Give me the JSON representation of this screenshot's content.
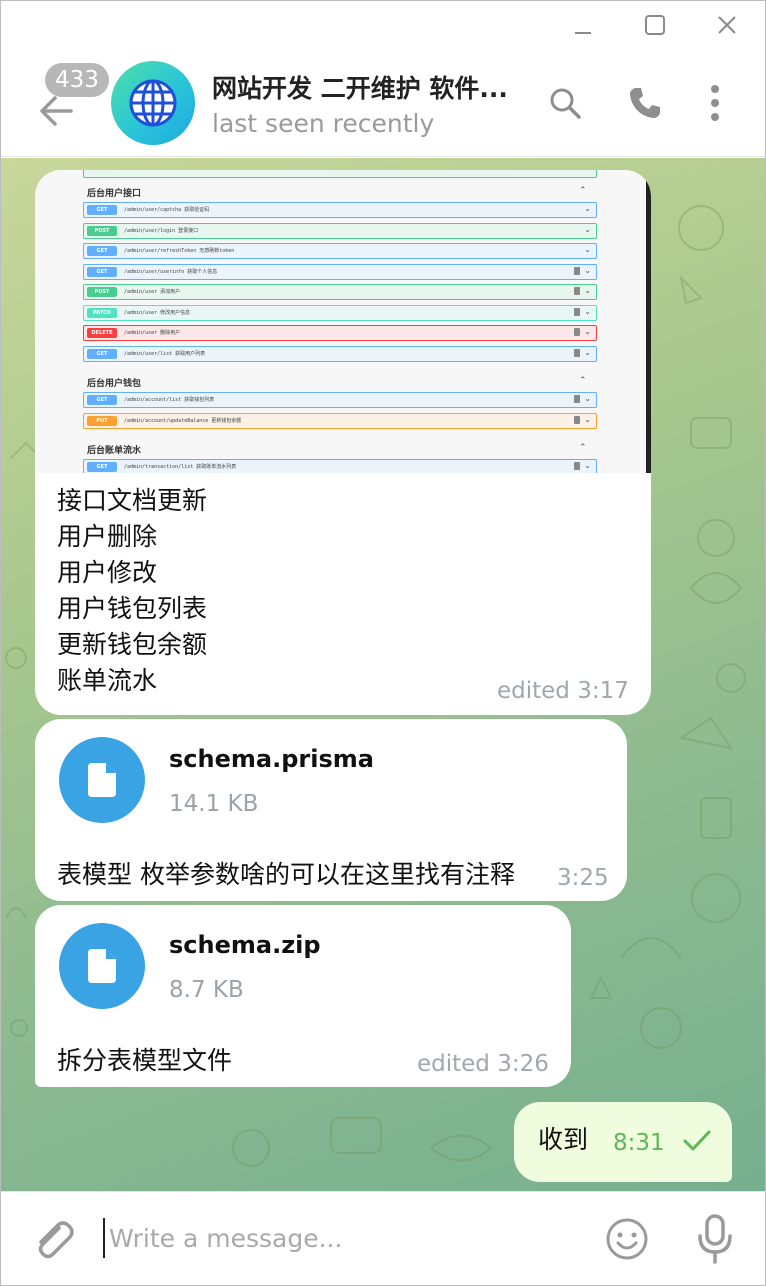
{
  "window": {
    "minimize_icon": "minimize-icon",
    "maximize_icon": "maximize-icon",
    "close_icon": "close-icon"
  },
  "header": {
    "unread_count": "433",
    "title": "网站开发 二开维护 软件...",
    "status": "last seen recently",
    "avatar_icon": "globe-icon",
    "icons": [
      "back-arrow-icon",
      "search-icon",
      "phone-icon",
      "more-vertical-icon"
    ]
  },
  "screenshot": {
    "sections": [
      {
        "title": "后台用户接口",
        "endpoints": [
          {
            "method": "GET",
            "path": "/admin/user/captcha  获取验证码",
            "locked": false
          },
          {
            "method": "POST",
            "path": "/admin/user/login  登录接口",
            "locked": false
          },
          {
            "method": "GET",
            "path": "/admin/user/refreshToken  无感刷新token",
            "locked": false
          },
          {
            "method": "GET",
            "path": "/admin/user/userinfo  获取个人信息",
            "locked": true
          },
          {
            "method": "POST",
            "path": "/admin/user  添加用户",
            "locked": true
          },
          {
            "method": "PATCH",
            "path": "/admin/user  修改用户信息",
            "locked": true
          },
          {
            "method": "DELETE",
            "path": "/admin/user  删除用户",
            "locked": true
          },
          {
            "method": "GET",
            "path": "/admin/user/list  获取用户列表",
            "locked": true
          }
        ]
      },
      {
        "title": "后台用户钱包",
        "endpoints": [
          {
            "method": "GET",
            "path": "/admin/account/list  获取钱包列表",
            "locked": true
          },
          {
            "method": "PUT",
            "path": "/admin/account/updateBalance  更新钱包余额",
            "locked": true
          }
        ]
      },
      {
        "title": "后台账单流水",
        "endpoints": [
          {
            "method": "GET",
            "path": "/admin/transaction/list  获取账单流水列表",
            "locked": true
          }
        ]
      }
    ]
  },
  "messages": {
    "m1": {
      "lines": [
        "接口文档更新",
        "用户删除",
        "用户修改",
        "用户钱包列表",
        "更新钱包余额",
        "账单流水"
      ],
      "time": "edited 3:17"
    },
    "m2": {
      "file_name": "schema.prisma",
      "file_size": "14.1 KB",
      "caption": "表模型 枚举参数啥的可以在这里找有注释",
      "time": "3:25",
      "icon": "file-icon"
    },
    "m3": {
      "file_name": "schema.zip",
      "file_size": "8.7 KB",
      "caption": "拆分表模型文件",
      "time": "edited 3:26",
      "icon": "file-icon"
    },
    "m4": {
      "text": "收到",
      "time": "8:31",
      "status_icon": "read-check-icon"
    }
  },
  "composer": {
    "placeholder": "Write a message...",
    "icons": [
      "paperclip-icon",
      "emoji-icon",
      "microphone-icon"
    ]
  },
  "colors": {
    "accent": "#3aa3e3",
    "outgoing_bubble": "#effdde",
    "outgoing_time": "#5fb655",
    "badge": "#b7b7b7"
  }
}
